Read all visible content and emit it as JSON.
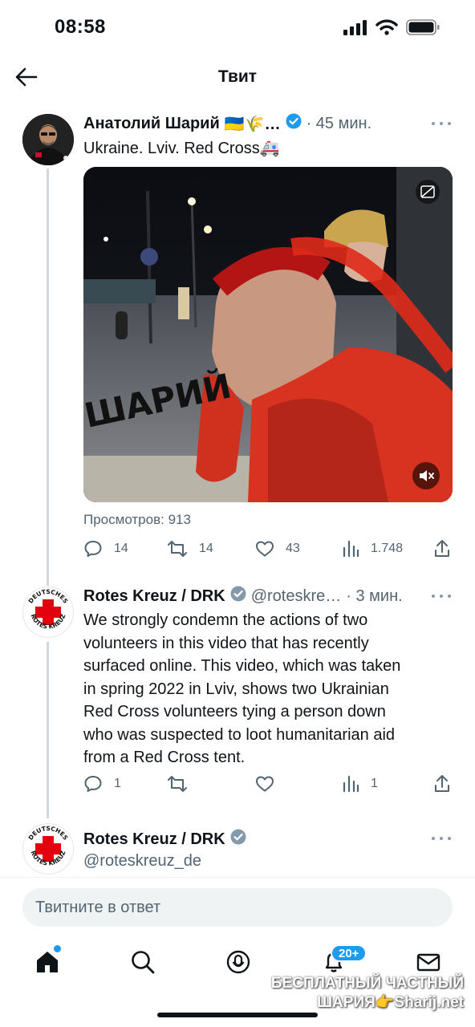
{
  "status_bar": {
    "time": "08:58"
  },
  "nav": {
    "title": "Твит"
  },
  "tweet1": {
    "author": "Анатолий Шарий",
    "author_flair": "🇺🇦🌾…",
    "time": "· 45 мин.",
    "text": "Ukraine. Lviv. Red Cross🚑",
    "video_watermark": "ШАРИЙ",
    "views": "Просмотров: 913",
    "replies": "14",
    "retweets": "14",
    "likes": "43",
    "view_count": "1.748"
  },
  "tweet2": {
    "author": "Rotes Kreuz / DRK",
    "handle": "@roteskre…",
    "time": "· 3 мин.",
    "text_lines": [
      "We strongly condemn the actions of two",
      "volunteers in this video that has recently",
      "surfaced online. This video, which was taken",
      "in spring 2022 in Lviv, shows two Ukrainian",
      "Red Cross volunteers tying a person down",
      "who was suspected to loot humanitarian aid",
      "from a Red Cross tent."
    ],
    "replies": "1",
    "retweets": "",
    "likes": "",
    "view_count": "1"
  },
  "tweet3": {
    "author": "Rotes Kreuz / DRK",
    "handle": "@roteskreuz_de"
  },
  "reply": {
    "placeholder": "Твитните в ответ"
  },
  "tabs": {
    "notifications_badge": "20+"
  },
  "watermark": {
    "line1": "БЕСПЛАТНЫЙ ЧАСТНЫЙ",
    "line2": "ШАРИЯ👉Sharij.net"
  },
  "colors": {
    "accent": "#1d9bf0",
    "secondary_text": "#536471",
    "thread_line": "#cfd9de"
  }
}
